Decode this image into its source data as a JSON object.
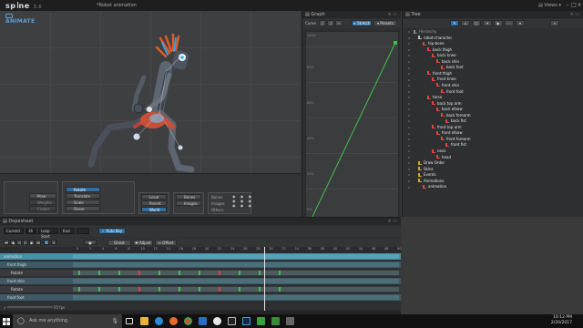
{
  "app": {
    "logo_text": "sp ine",
    "version": "3.6",
    "file_title": "*Robot animation",
    "views_label": "Views",
    "mode": "ANIMATE"
  },
  "tools": {
    "pose": "Pose",
    "weights": "Weights",
    "create": "Create",
    "rotate": "Rotate",
    "translate": "Translate",
    "scale": "Scale",
    "shear": "Shear",
    "local": "Local",
    "parent": "Parent",
    "world": "World",
    "bones": "Bones",
    "images": "Images",
    "vis_bones": "Bones",
    "vis_images": "Images",
    "vis_others": "Others"
  },
  "graph": {
    "title": "Graph",
    "curve_label": "Curve",
    "stretch_label": "Stretch",
    "presets_label": "Presets",
    "y_labels": [
      "100%",
      "80%",
      "60%",
      "40%",
      "20%",
      "0%"
    ]
  },
  "tree": {
    "title": "Tree",
    "items": [
      {
        "label": "Hierarchy",
        "indent": 0,
        "color": "#9a9a9a"
      },
      {
        "label": "robot-character",
        "indent": 1,
        "color": "#e8e8e8"
      },
      {
        "label": "hip-bone",
        "indent": 2,
        "color": "#e8e8e8"
      },
      {
        "label": "back thigh",
        "indent": 3,
        "color": "#e8e8e8"
      },
      {
        "label": "back knee",
        "indent": 4,
        "color": "#e8e8e8"
      },
      {
        "label": "back shin",
        "indent": 5,
        "color": "#e8e8e8"
      },
      {
        "label": "back foot",
        "indent": 6,
        "color": "#e8e8e8"
      },
      {
        "label": "front thigh",
        "indent": 3,
        "color": "#e8e8e8"
      },
      {
        "label": "front knee",
        "indent": 4,
        "color": "#e8e8e8"
      },
      {
        "label": "front shin",
        "indent": 5,
        "color": "#e8e8e8"
      },
      {
        "label": "front foot",
        "indent": 6,
        "color": "#e8e8e8"
      },
      {
        "label": "torso",
        "indent": 3,
        "color": "#e8e8e8"
      },
      {
        "label": "back top arm",
        "indent": 4,
        "color": "#e8e8e8"
      },
      {
        "label": "back elbow",
        "indent": 5,
        "color": "#e8e8e8"
      },
      {
        "label": "back forearm",
        "indent": 6,
        "color": "#e8e8e8"
      },
      {
        "label": "back fist",
        "indent": 7,
        "color": "#e8e8e8"
      },
      {
        "label": "front top arm",
        "indent": 4,
        "color": "#e8e8e8"
      },
      {
        "label": "front elbow",
        "indent": 5,
        "color": "#e8e8e8"
      },
      {
        "label": "front forearm",
        "indent": 6,
        "color": "#e8e8e8"
      },
      {
        "label": "front fist",
        "indent": 7,
        "color": "#e8e8e8"
      },
      {
        "label": "neck",
        "indent": 4,
        "color": "#e8e8e8"
      },
      {
        "label": "head",
        "indent": 5,
        "color": "#e8e8e8"
      },
      {
        "label": "Draw Order",
        "indent": 1,
        "color": "#e8e8e8"
      },
      {
        "label": "Skins",
        "indent": 1,
        "color": "#e8e8e8"
      },
      {
        "label": "Events",
        "indent": 1,
        "color": "#e8e8e8"
      },
      {
        "label": "Animations",
        "indent": 1,
        "color": "#e8e8e8"
      },
      {
        "label": "animation",
        "indent": 2,
        "color": "#e8e8e8"
      }
    ]
  },
  "dopesheet": {
    "title": "Dopesheet",
    "current_label": "Current",
    "current_value": "36",
    "loop_start_label": "Loop Start",
    "end_label": "End",
    "auto_key": "Auto Key",
    "ghost_label": "Ghost",
    "adjust_label": "Adjust",
    "offset_label": "Offset",
    "ruler": [
      "0",
      "2",
      "4",
      "6",
      "8",
      "10",
      "12",
      "14",
      "16",
      "18",
      "20",
      "22",
      "24",
      "26",
      "28",
      "30",
      "32",
      "34",
      "36",
      "38",
      "40",
      "42",
      "44",
      "46",
      "48",
      "50"
    ],
    "rows": [
      {
        "label": "animation",
        "type": "header"
      },
      {
        "label": "front thigh",
        "type": "bone"
      },
      {
        "label": "Rotate",
        "type": "prop"
      },
      {
        "label": "front shin",
        "type": "bone"
      },
      {
        "label": "Rotate",
        "type": "prop"
      },
      {
        "label": "front foot",
        "type": "bone"
      }
    ],
    "zoom_value": "50",
    "fps_label": "fps"
  },
  "taskbar": {
    "search_placeholder": "Ask me anything",
    "time": "10:12 PM",
    "date": "2/20/2017"
  },
  "colors": {
    "accent": "#2f6fa5",
    "key": "#3ec04a",
    "curve": "#3ec04a"
  }
}
